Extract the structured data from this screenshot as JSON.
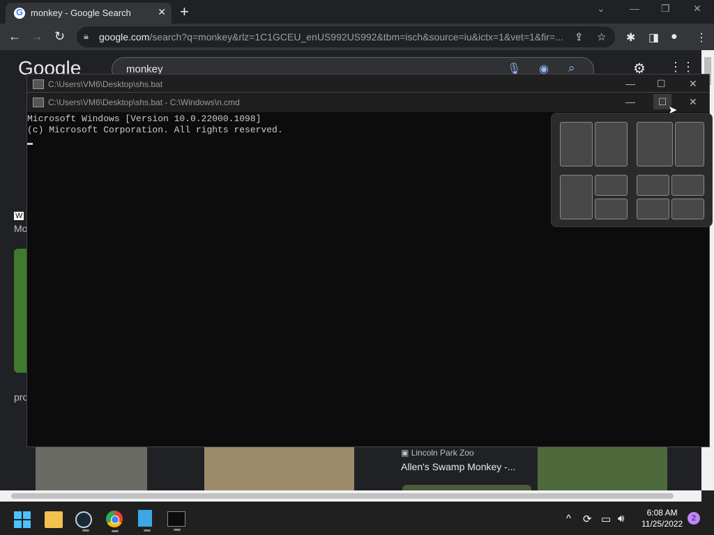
{
  "browser": {
    "tab_title": "monkey - Google Search",
    "url_host": "google.com",
    "url_rest": "/search?q=monkey&rlz=1C1GCEU_enUS992US992&tbm=isch&source=iu&ictx=1&vet=1&fir=..."
  },
  "google": {
    "logo": "Google",
    "query": "monkey",
    "result_source": "Lincoln Park Zoo",
    "result_title": "Allen's Swamp Monkey -...",
    "left_snippet_1": "Mo",
    "left_snippet_2": "pro"
  },
  "cmd_back": {
    "title": "C:\\Users\\VM6\\Desktop\\shs.bat"
  },
  "cmd_front": {
    "title": "C:\\Users\\VM6\\Desktop\\shs.bat - C:\\Windows\\n.cmd",
    "line1": "Microsoft Windows [Version 10.0.22000.1098]",
    "line2": "(c) Microsoft Corporation. All rights reserved."
  },
  "taskbar": {
    "time": "6:08 AM",
    "date": "11/25/2022",
    "notifications": "2"
  },
  "colors": {
    "accent": "#8ab4f8",
    "console_bg": "#0c0c0c",
    "taskbar": "#202020"
  }
}
